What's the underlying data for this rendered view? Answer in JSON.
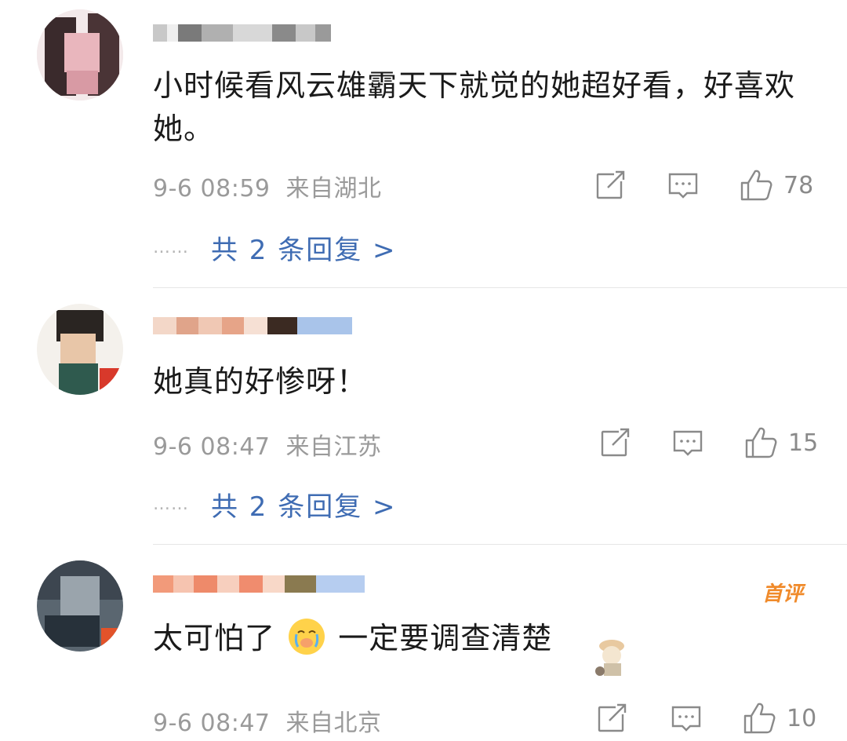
{
  "comments": [
    {
      "text": "小时候看风云雄霸天下就觉的她超好看，好喜欢她。",
      "time": "9-6 08:59",
      "location": "来自湖北",
      "likes": "78",
      "replies_dots": "……",
      "replies_link": "共 2 条回复 >"
    },
    {
      "text": "她真的好惨呀！",
      "time": "9-6 08:47",
      "location": "来自江苏",
      "likes": "15",
      "replies_dots": "……",
      "replies_link": "共 2 条回复 >"
    },
    {
      "text_part1": "太可怕了",
      "text_part2": "一定要调查清楚",
      "time": "9-6 08:47",
      "location": "来自北京",
      "likes": "10",
      "badge": "首评"
    }
  ],
  "icons": {
    "share": "share-icon",
    "comment": "comment-icon",
    "like": "thumbs-up-icon",
    "emoji": "crying-face-emoji-icon"
  },
  "colors": {
    "link": "#3f6cb3",
    "meta": "#9a9a9a",
    "text": "#1a1a1a",
    "badge": "#f08a2a"
  }
}
